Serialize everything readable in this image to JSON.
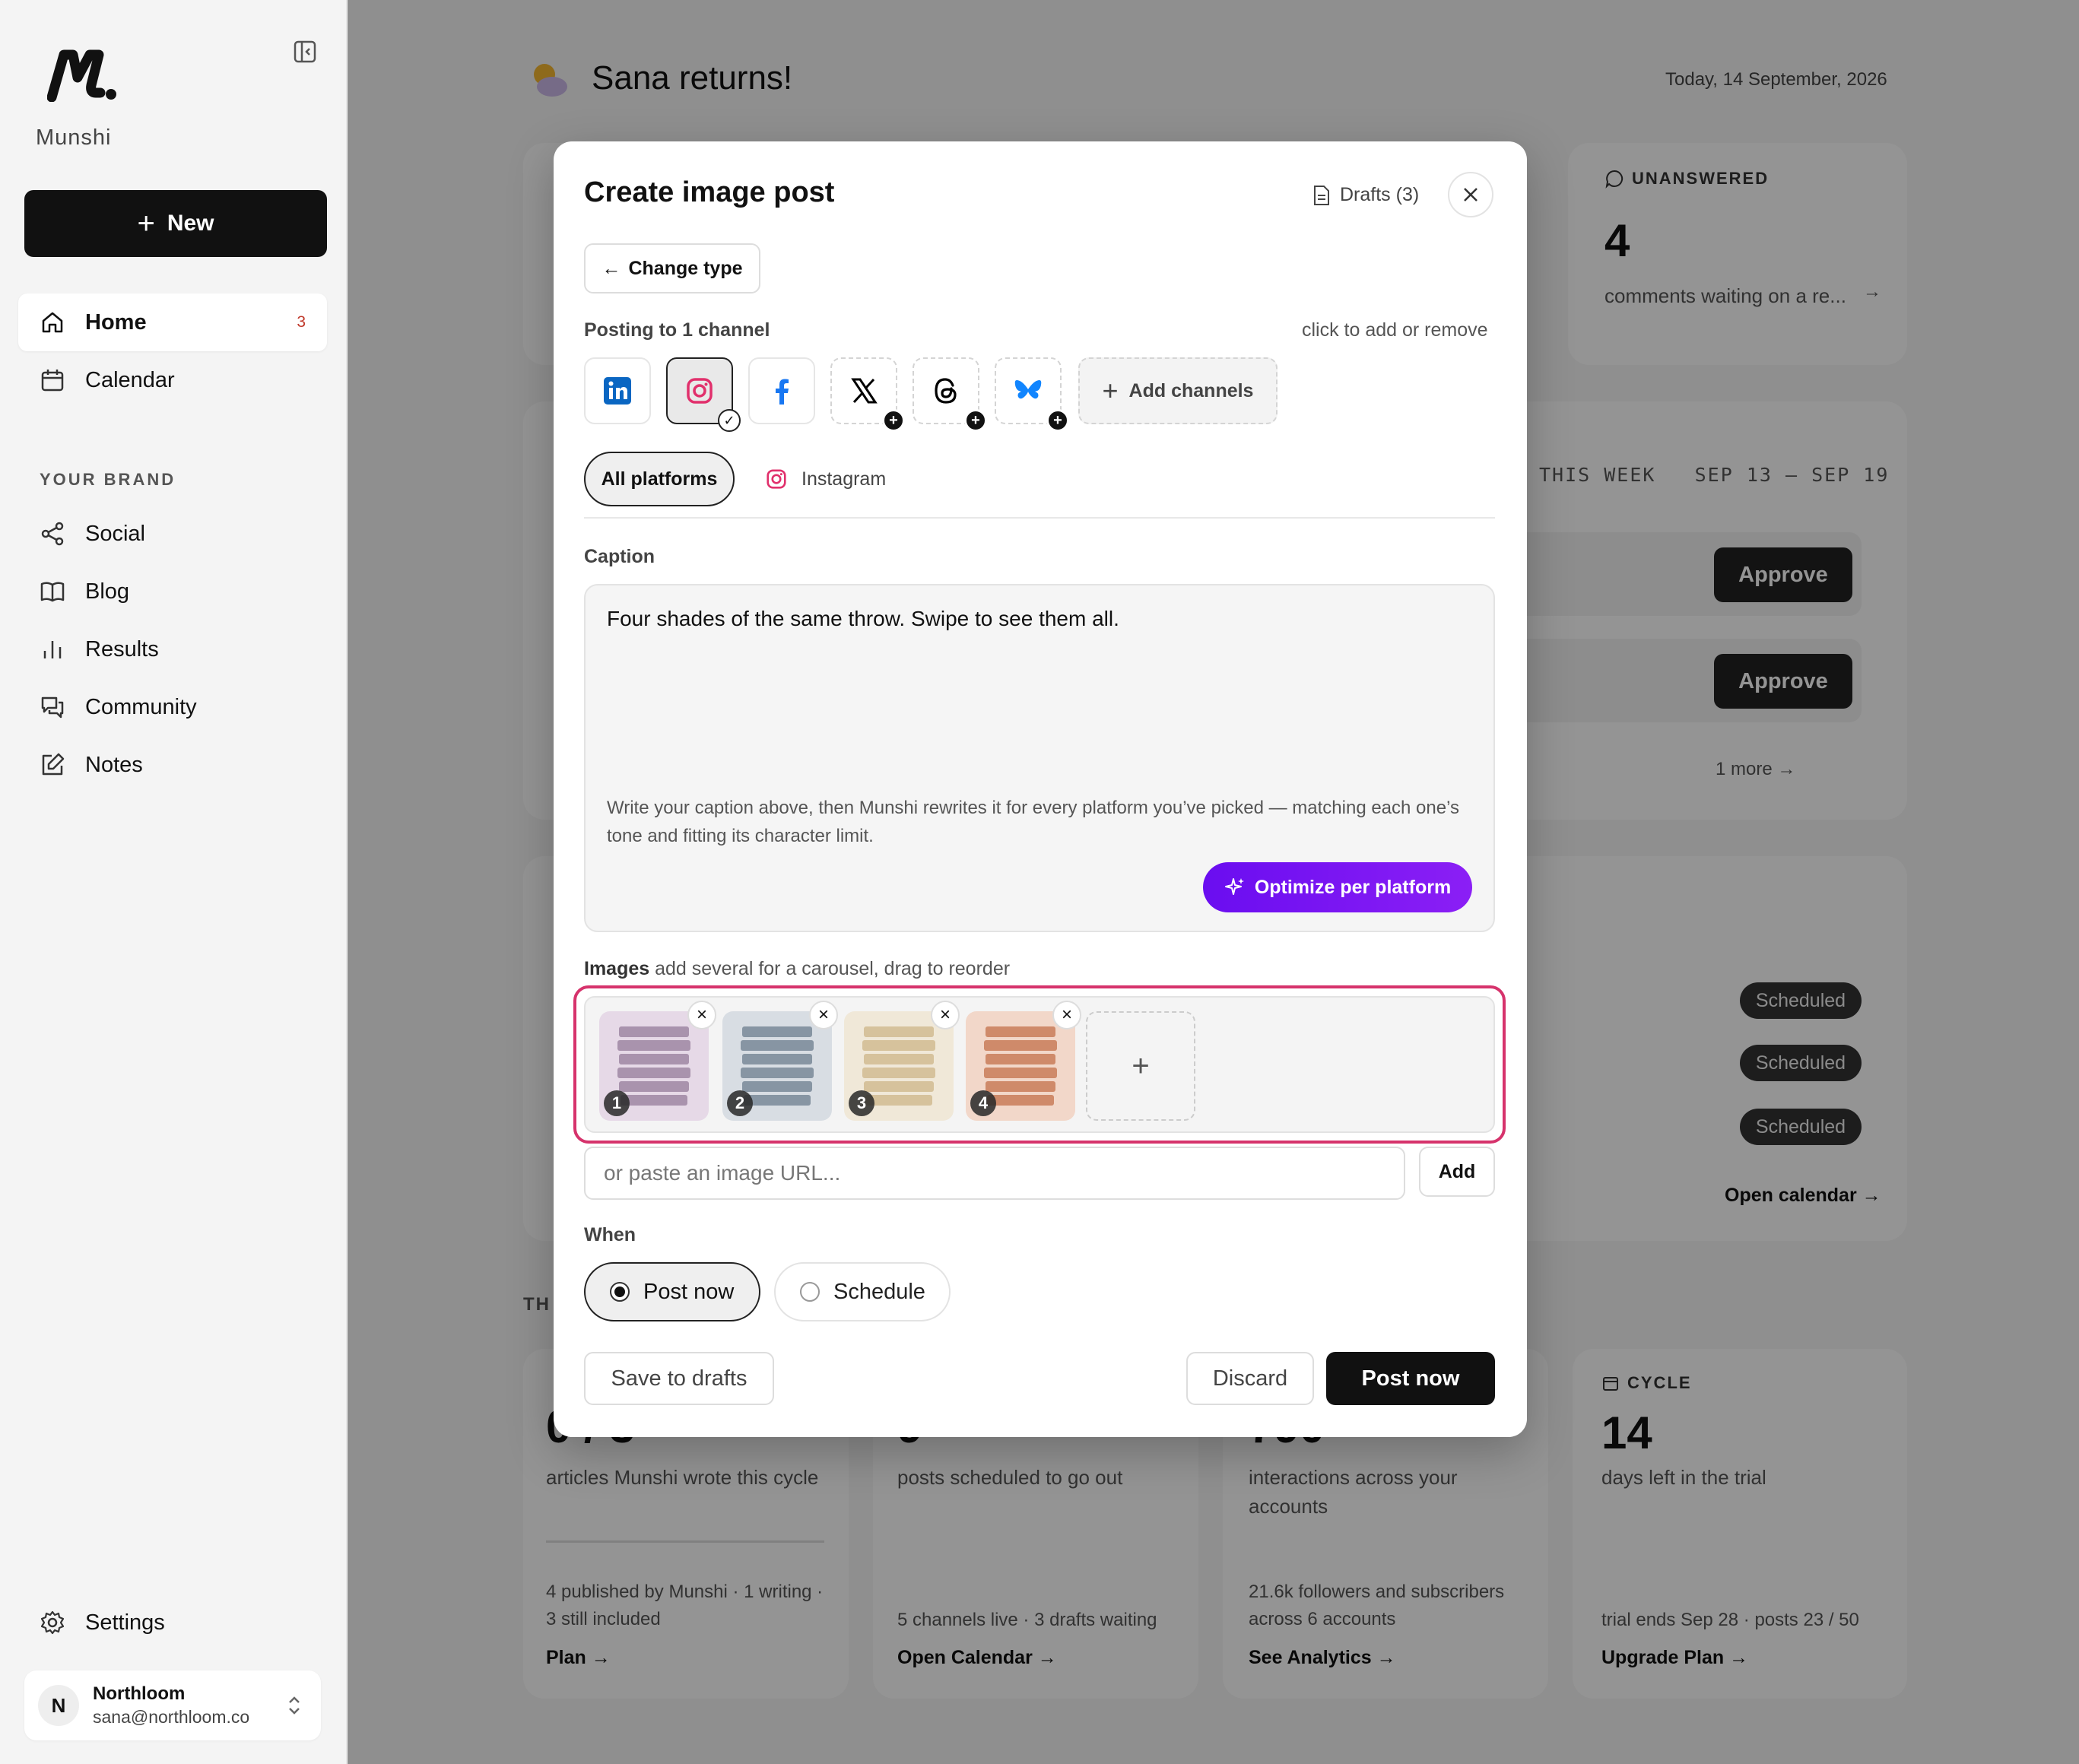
{
  "sidebar": {
    "brand": "Munshi",
    "new_label": "New",
    "nav": [
      {
        "label": "Home",
        "badge": "3"
      },
      {
        "label": "Calendar"
      }
    ],
    "section_label": "YOUR BRAND",
    "brand_nav": [
      {
        "label": "Social"
      },
      {
        "label": "Blog"
      },
      {
        "label": "Results"
      },
      {
        "label": "Community"
      },
      {
        "label": "Notes"
      }
    ],
    "settings_label": "Settings",
    "account": {
      "initial": "N",
      "name": "Northloom",
      "email": "sana@northloom.co"
    }
  },
  "dashboard": {
    "greeting": "Sana returns!",
    "date": "Today, 14 September, 2026",
    "unanswered": {
      "label": "UNANSWERED",
      "value": "4",
      "desc": "comments waiting on a re..."
    },
    "this_week": {
      "label": "THIS WEEK",
      "range": "SEP 13 – SEP 19",
      "approve_label": "Approve",
      "more": "1 more"
    },
    "scheduled_label": "Scheduled",
    "open_calendar_link": "Open calendar →",
    "section_prefix": "TH",
    "stats": [
      {
        "value_partial": "0 / 3",
        "desc": "articles Munshi wrote this cycle",
        "foot": "4 published by Munshi · 1 writing · 3 still included",
        "link": "Plan →"
      },
      {
        "value_partial": "9",
        "desc": "posts scheduled to go out",
        "foot": "5 channels live · 3 drafts waiting",
        "link": "Open Calendar →"
      },
      {
        "value_partial": "790",
        "desc": "interactions across your accounts",
        "foot": "21.6k followers and subscribers across 6 accounts",
        "link": "See Analytics →"
      },
      {
        "label": "CYCLE",
        "value": "14",
        "desc": "days left in the trial",
        "foot": "trial ends Sep 28 · posts 23 / 50",
        "link": "Upgrade Plan →"
      }
    ]
  },
  "modal": {
    "title": "Create image post",
    "drafts_label": "Drafts (3)",
    "change_type_label": "Change type",
    "posting_label": "Posting to 1 channel",
    "click_hint": "click to add or remove",
    "channels": [
      {
        "name": "linkedin-icon",
        "state": "available",
        "color": "#0a66c2"
      },
      {
        "name": "instagram-icon",
        "state": "selected",
        "color": "#e1306c"
      },
      {
        "name": "facebook-icon",
        "state": "available",
        "color": "#1877f2"
      },
      {
        "name": "x-icon",
        "state": "addable",
        "color": "#000000"
      },
      {
        "name": "threads-icon",
        "state": "addable",
        "color": "#000000"
      },
      {
        "name": "bluesky-icon",
        "state": "addable",
        "color": "#1185fe"
      }
    ],
    "add_channels_label": "Add channels",
    "tabs": {
      "all": "All platforms",
      "instagram": "Instagram"
    },
    "caption_label": "Caption",
    "caption_value": "Four shades of the same throw. Swipe to see them all.",
    "caption_help": "Write your caption above, then Munshi rewrites it for every platform you’ve picked — matching each one’s tone and fitting its character limit.",
    "optimize_label": "Optimize per platform",
    "images_label": "Images",
    "images_hint": "add several for a carousel, drag to reorder",
    "images": [
      {
        "index": "1",
        "color": "#a993ad"
      },
      {
        "index": "2",
        "color": "#8795a3"
      },
      {
        "index": "3",
        "color": "#d6c29c"
      },
      {
        "index": "4",
        "color": "#cf8a6a"
      }
    ],
    "url_placeholder": "or paste an image URL...",
    "add_url_label": "Add",
    "when_label": "When",
    "when_options": {
      "now": "Post now",
      "schedule": "Schedule"
    },
    "save_drafts_label": "Save to drafts",
    "discard_label": "Discard",
    "post_now_label": "Post now"
  }
}
